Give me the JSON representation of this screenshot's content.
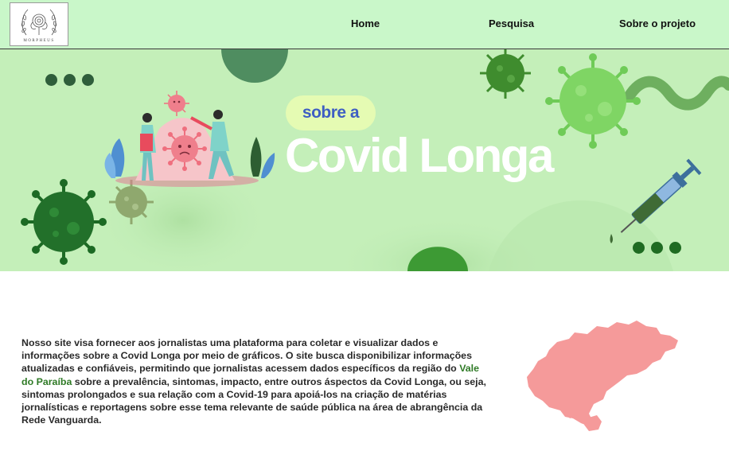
{
  "header": {
    "logo_text": "MORPHEUS",
    "nav": {
      "home": "Home",
      "pesquisa": "Pesquisa",
      "sobre": "Sobre o projeto"
    }
  },
  "hero": {
    "pill_text": "sobre a",
    "title": "Covid Longa"
  },
  "content": {
    "paragraph_before": "Nosso site visa fornecer aos jornalistas uma plataforma para coletar e visualizar dados e informações sobre a Covid Longa por meio de gráficos. O site busca disponibilizar informações atualizadas e confiáveis, permitindo que jornalistas acessem dados específicos da região do ",
    "highlight": "Vale do Paraíba",
    "paragraph_after": " sobre a prevalência, sintomas, impacto, entre outros áspectos da Covid Longa, ou seja, sintomas prolongados e sua relação com a Covid-19 para apoiá-los na criação de matérias jornalísticas e reportagens sobre esse tema relevante de saúde pública na área de abrangência da Rede Vanguarda."
  },
  "colors": {
    "nav_bg": "#c9f7c9",
    "hero_bg": "#c4efb9",
    "title": "#ffffff",
    "pill_bg": "#e5fbb3",
    "pill_text": "#3e5ec3",
    "highlight": "#2f7a26",
    "map_fill": "#f59a9a"
  }
}
